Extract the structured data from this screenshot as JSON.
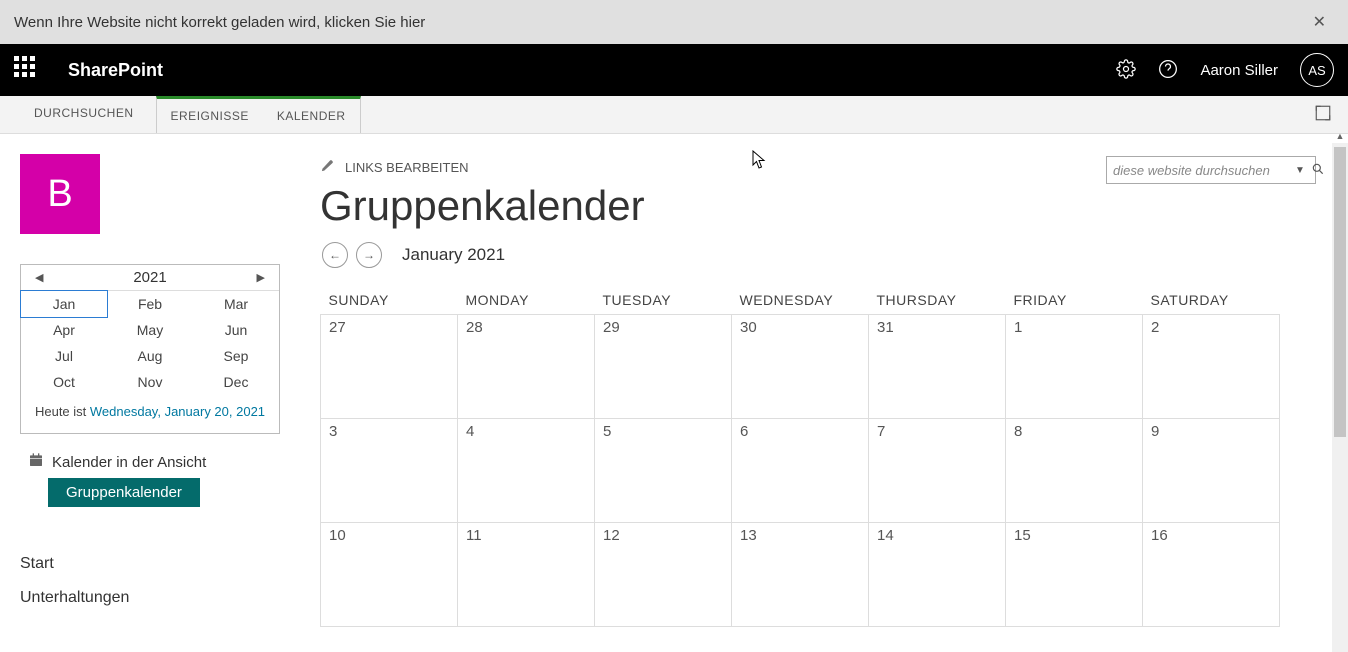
{
  "banner": {
    "text": "Wenn Ihre Website nicht korrekt geladen wird, klicken Sie hier"
  },
  "topbar": {
    "brand": "SharePoint",
    "user_name": "Aaron Siller",
    "user_initials": "AS"
  },
  "ribbon": {
    "tabs": [
      "DURCHSUCHEN",
      "EREIGNISSE",
      "KALENDER"
    ]
  },
  "header": {
    "site_letter": "B",
    "edit_links_label": "LINKS BEARBEITEN",
    "page_title": "Gruppenkalender"
  },
  "search": {
    "placeholder": "diese website durchsuchen"
  },
  "minical": {
    "year": "2021",
    "months": [
      "Jan",
      "Feb",
      "Mar",
      "Apr",
      "May",
      "Jun",
      "Jul",
      "Aug",
      "Sep",
      "Oct",
      "Nov",
      "Dec"
    ],
    "selected": "Jan",
    "today_prefix": "Heute ist ",
    "today_link": "Wednesday, January 20, 2021"
  },
  "views": {
    "section_label": "Kalender in der Ansicht",
    "current": "Gruppenkalender"
  },
  "leftnav": {
    "items": [
      "Start",
      "Unterhaltungen"
    ]
  },
  "calendar": {
    "title": "January 2021",
    "day_headers": [
      "SUNDAY",
      "MONDAY",
      "TUESDAY",
      "WEDNESDAY",
      "THURSDAY",
      "FRIDAY",
      "SATURDAY"
    ],
    "rows": [
      [
        "27",
        "28",
        "29",
        "30",
        "31",
        "1",
        "2"
      ],
      [
        "3",
        "4",
        "5",
        "6",
        "7",
        "8",
        "9"
      ],
      [
        "10",
        "11",
        "12",
        "13",
        "14",
        "15",
        "16"
      ]
    ]
  }
}
